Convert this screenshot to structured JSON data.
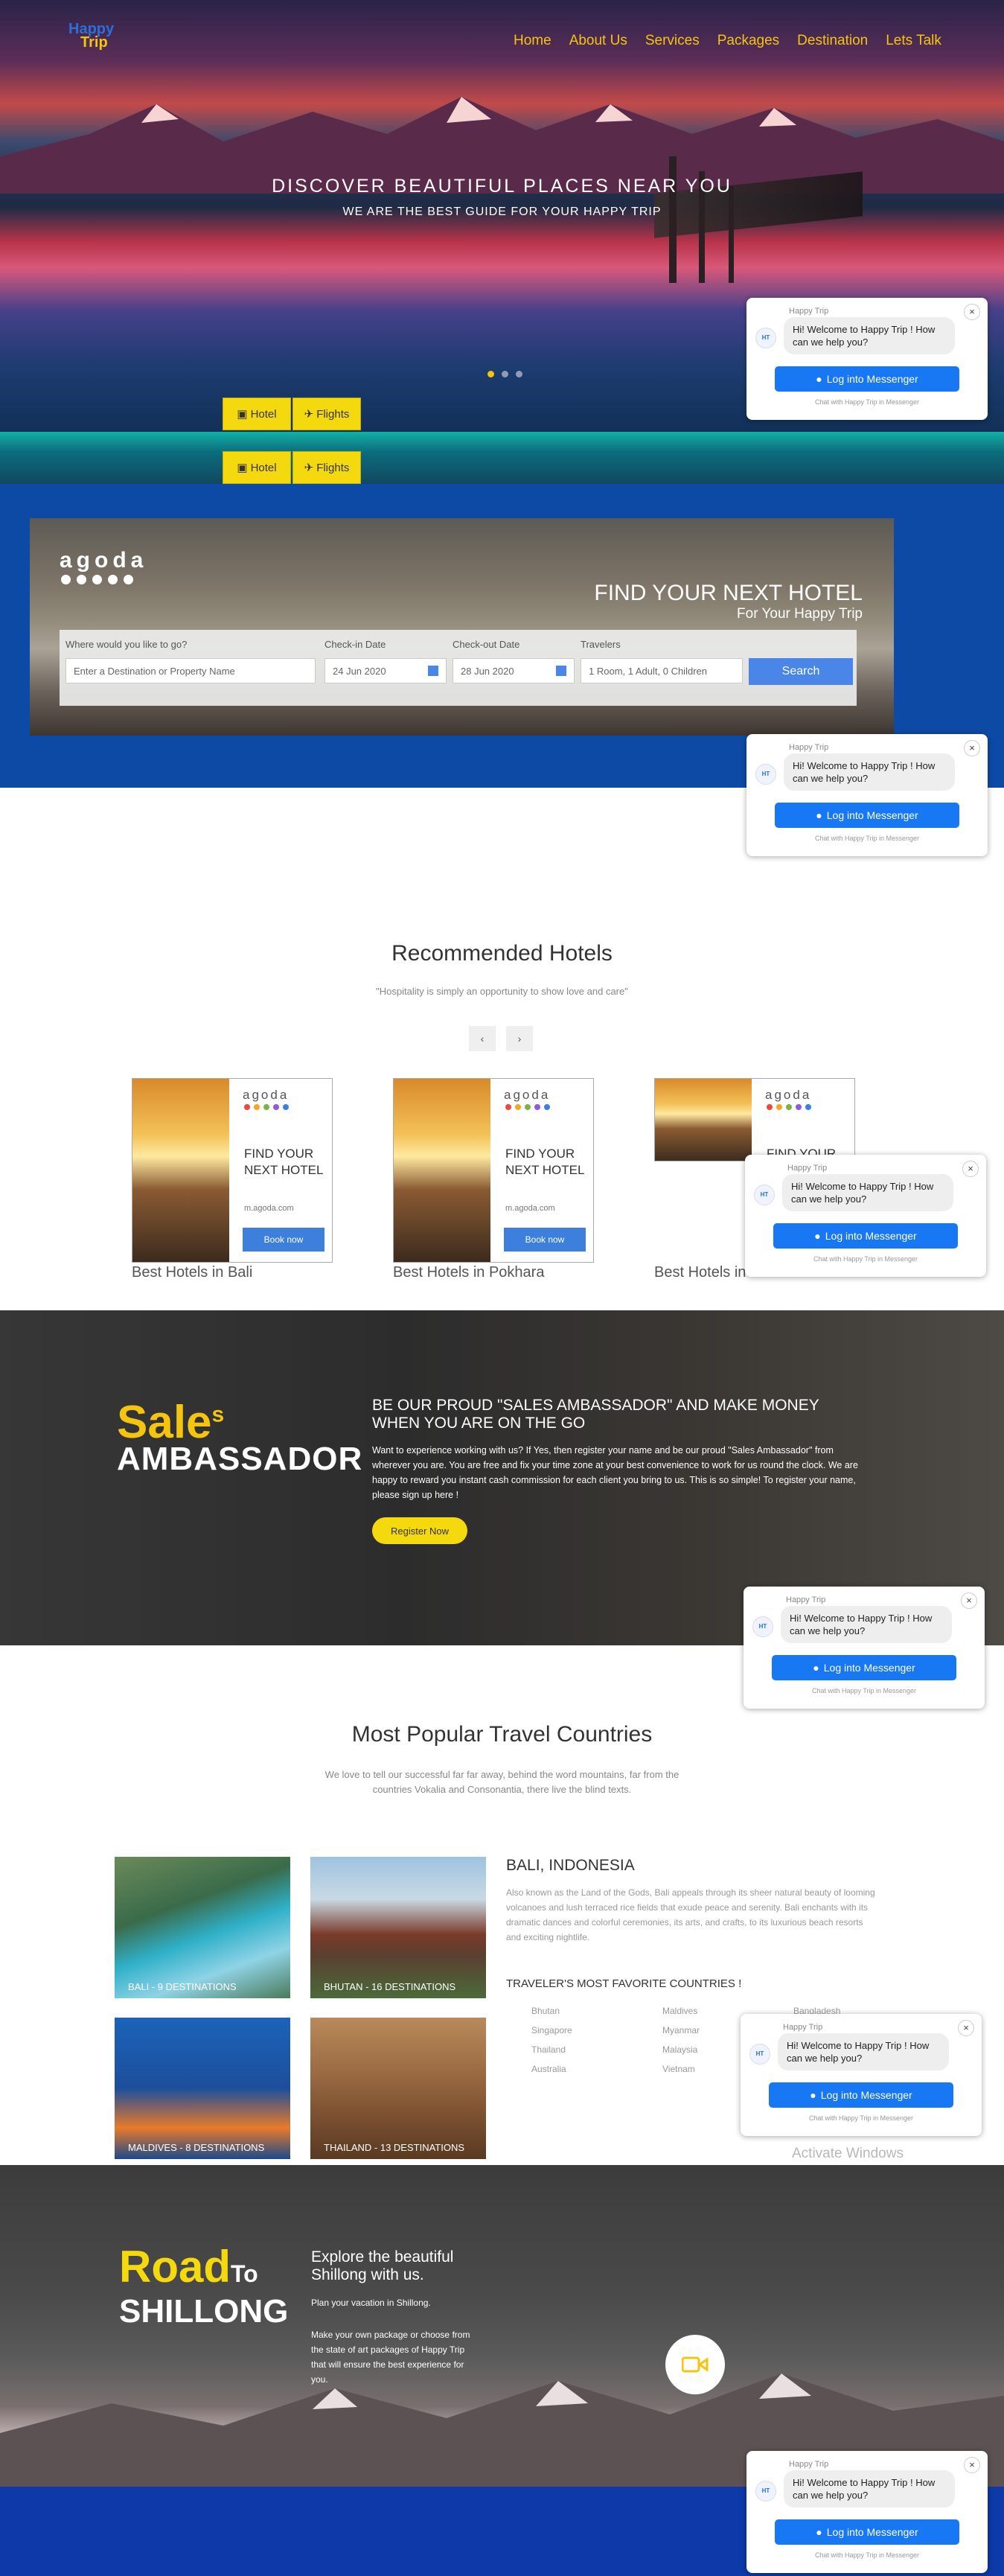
{
  "brand": {
    "line1": "Happy",
    "line2": "Trip"
  },
  "nav": [
    "Home",
    "About Us",
    "Services",
    "Packages",
    "Destination",
    "Lets Talk"
  ],
  "hero": {
    "title": "DISCOVER BEAUTIFUL PLACES NEAR YOU",
    "subtitle": "WE ARE THE BEST GUIDE FOR YOUR HAPPY TRIP"
  },
  "tabs": {
    "hotel": "Hotel",
    "flights": "Flights"
  },
  "agoda": {
    "logo": "agoda",
    "title": "FIND YOUR NEXT HOTEL",
    "subtitle": "For Your Happy Trip",
    "where_label": "Where would you like to go?",
    "where_placeholder": "Enter a Destination or Property Name",
    "checkin_label": "Check-in Date",
    "checkin_value": "24 Jun 2020",
    "checkout_label": "Check-out Date",
    "checkout_value": "28 Jun 2020",
    "travelers_label": "Travelers",
    "travelers_value": "1 Room, 1 Adult, 0 Children",
    "search": "Search"
  },
  "messenger": {
    "name": "Happy Trip",
    "greeting": "Hi! Welcome to Happy Trip ! How can we help you?",
    "login": "Log into Messenger",
    "footer": "Chat with Happy Trip in Messenger",
    "close": "×",
    "avatar": "HT"
  },
  "recommended": {
    "title": "Recommended Hotels",
    "quote": "\"Hospitality is simply an opportunity to show love and care\"",
    "prev": "‹",
    "next": "›",
    "card_brand": "agoda",
    "card_text": "FIND YOUR NEXT HOTEL",
    "card_url": "m.agoda.com",
    "card_btn": "Book now",
    "hotels": [
      "Best Hotels in Bali",
      "Best Hotels in Pokhara",
      "Best Hotels in"
    ]
  },
  "sales": {
    "big1": "Sale",
    "big1_sup": "s",
    "big2": "AMBASSADOR",
    "heading": "BE OUR PROUD \"SALES AMBASSADOR\" AND MAKE MONEY WHEN YOU ARE ON THE GO",
    "body": "Want to experience working with us? If Yes, then register your name and be our proud \"Sales Ambassador\" from wherever you are. You are free and fix your time zone at your best convenience to work for us round the clock. We are happy to reward you instant cash commission for each client you bring to us. This is so simple! To register your name, please sign up here !",
    "button": "Register Now"
  },
  "countries": {
    "title": "Most Popular Travel Countries",
    "subtitle": "We love to tell our successful far far away, behind the word mountains, far from the countries Vokalia and Consonantia, there live the blind texts.",
    "cards": [
      "BALI - 9 DESTINATIONS",
      "BHUTAN - 16 DESTINATIONS",
      "MALDIVES - 8 DESTINATIONS",
      "THAILAND - 13 DESTINATIONS"
    ],
    "feature_title": "BALI, INDONESIA",
    "feature_text": "Also known as the Land of the Gods, Bali appeals through its sheer natural beauty of looming volcanoes and lush terraced rice fields that exude peace and serenity. Bali enchants with its dramatic dances and colorful ceremonies, its arts, and crafts, to its luxurious beach resorts and exciting nightlife.",
    "fav_title": "TRAVELER'S MOST FAVORITE COUNTRIES !",
    "fav": [
      "Bhutan",
      "Maldives",
      "Bangladesh",
      "Singapore",
      "Myanmar",
      "",
      "Thailand",
      "Malaysia",
      "",
      "Australia",
      "Vietnam",
      ""
    ]
  },
  "road": {
    "big1": "Road",
    "big1_small": "To",
    "big2": "SHILLONG",
    "heading": "Explore the beautiful Shillong with us.",
    "p1": "Plan your vacation in Shillong.",
    "p2": "Make your own package or choose from the state of art packages of Happy Trip that will ensure the best experience for you."
  },
  "windows": {
    "activate": "Activate Windows"
  },
  "colors": {
    "accent": "#f5c40f",
    "brand_blue": "#0d4aa6",
    "messenger_blue": "#1877f2"
  }
}
